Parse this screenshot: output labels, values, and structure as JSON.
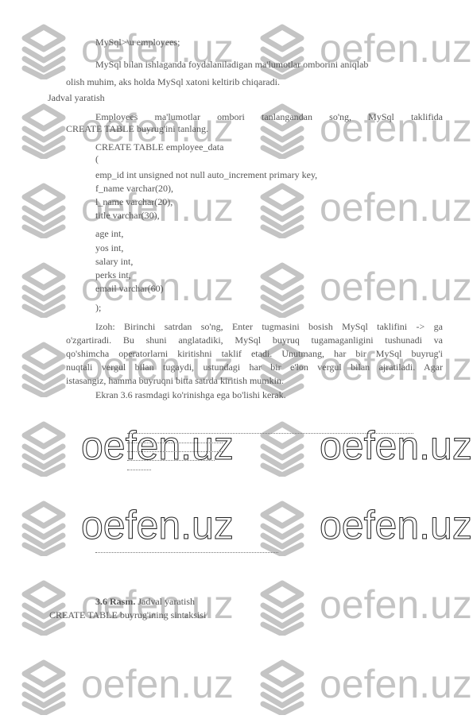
{
  "watermark": {
    "text": "oefen.uz",
    "icon": "stacked-layers-icon"
  },
  "lines": {
    "l1": "MySql>\\u employees;",
    "l2": "MySql bilan ishlaganda foydalaniladigan ma'lumotlar omborini aniqlab",
    "l3": "olish muhim, aks holda MySql xatoni keltirib chiqaradi.",
    "heading": "Jadval yaratish",
    "p1a": "Employees ma'lumotlar ombori tanlangandan so'ng, MySql taklifida",
    "p1b": "CREATE TABLE buyrug'ini tanlang.",
    "code": [
      "CREATE TABLE employee_data",
      "(",
      "emp_id int unsigned not null auto_increment primary key,",
      "f_name varchar(20),",
      "l_name varchar(20),",
      "title varchar(30),",
      "age int,",
      "yos int,",
      "salary int,",
      "perks int,",
      "email varchar(60)",
      ");"
    ],
    "note": [
      "Izoh: Birinchi satrdan so'ng, Enter tugmasini bosish MySql taklifini -> ga",
      "o'zgartiradi. Bu shuni anglatadiki, MySql buyruq tugamaganligini tushunadi va",
      "qo'shimcha operatorlarni kiritishni taklif etadi. Unutmang, har bir MySql buyrug'i",
      "nuqtali vergul bilan tugaydi, ustundagi har bir e'lon vergul bilan ajratiladi. Agar",
      "istasangiz, hamma buyruqni bitta satrda kiritish mumkin."
    ],
    "fig_intro": "Ekran 3.6 rasmdagi ko'rinishga ega bo'lishi kerak.",
    "caption_num": "3.6 Rasm.",
    "caption_text": " Jadval yaratish",
    "last": "CREATE TABLE buyrug'ining sintaksisi"
  }
}
